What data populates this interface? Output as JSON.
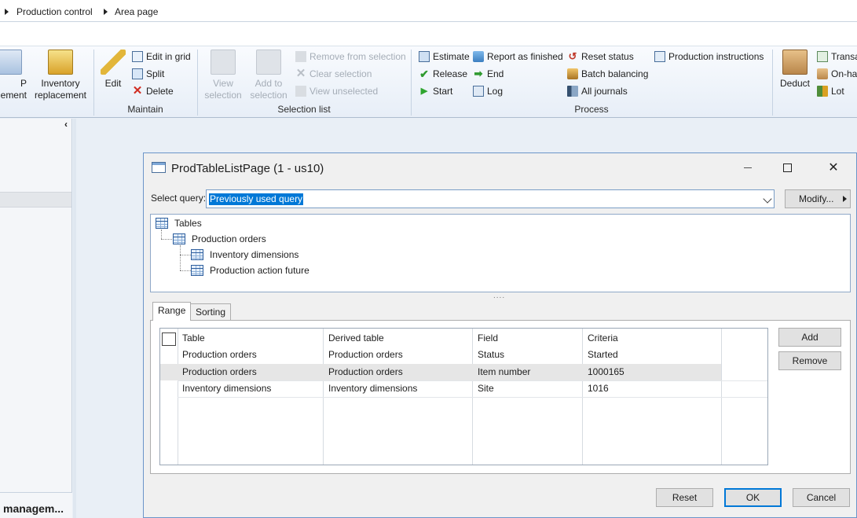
{
  "breadcrumb": {
    "items": [
      "Production control",
      "Area page"
    ]
  },
  "ribbon": {
    "partial_left": {
      "line1": "P",
      "line2": "ement"
    },
    "inventory_replacement": {
      "line1": "Inventory",
      "line2": "replacement"
    },
    "maintain": {
      "label": "Maintain",
      "edit": "Edit",
      "edit_in_grid": "Edit in grid",
      "split": "Split",
      "delete": "Delete"
    },
    "selection_list": {
      "label": "Selection list",
      "view_selection": {
        "line1": "View",
        "line2": "selection"
      },
      "add_to_selection": {
        "line1": "Add to",
        "line2": "selection"
      },
      "remove_from_selection": "Remove from selection",
      "clear_selection": "Clear selection",
      "view_unselected": "View unselected"
    },
    "process": {
      "label": "Process",
      "estimate": "Estimate",
      "release": "Release",
      "start": "Start",
      "report_as_finished": "Report as finished",
      "end": "End",
      "log": "Log",
      "reset_status": "Reset status",
      "batch_balancing": "Batch balancing",
      "all_journals": "All journals",
      "production_instructions": "Production instructions"
    },
    "deduct": "Deduct",
    "transactions_partial": "Transa",
    "on_hand_partial": "On-ha",
    "lot": "Lot"
  },
  "left_panel": {
    "bottom_label": "managem..."
  },
  "dialog": {
    "title": "ProdTableListPage (1 - us10)",
    "select_query_label": "Select query:",
    "select_query_value": "Previously used query",
    "modify_label": "Modify...",
    "tree": {
      "root": "Tables",
      "level1": "Production orders",
      "children": [
        "Inventory dimensions",
        "Production action future"
      ]
    },
    "tabs": [
      "Range",
      "Sorting"
    ],
    "grid": {
      "headers": [
        "Table",
        "Derived table",
        "Field",
        "Criteria"
      ],
      "rows": [
        [
          "Production orders",
          "Production orders",
          "Status",
          "Started"
        ],
        [
          "Production orders",
          "Production orders",
          "Item number",
          "1000165"
        ],
        [
          "Inventory dimensions",
          "Inventory dimensions",
          "Site",
          "1016"
        ]
      ]
    },
    "add_label": "Add",
    "remove_label": "Remove",
    "reset_label": "Reset",
    "ok_label": "OK",
    "cancel_label": "Cancel"
  },
  "colors": {
    "accent": "#0078d7",
    "ribbon_bg": "#e7eef7",
    "dialog_border": "#6b95c9"
  }
}
